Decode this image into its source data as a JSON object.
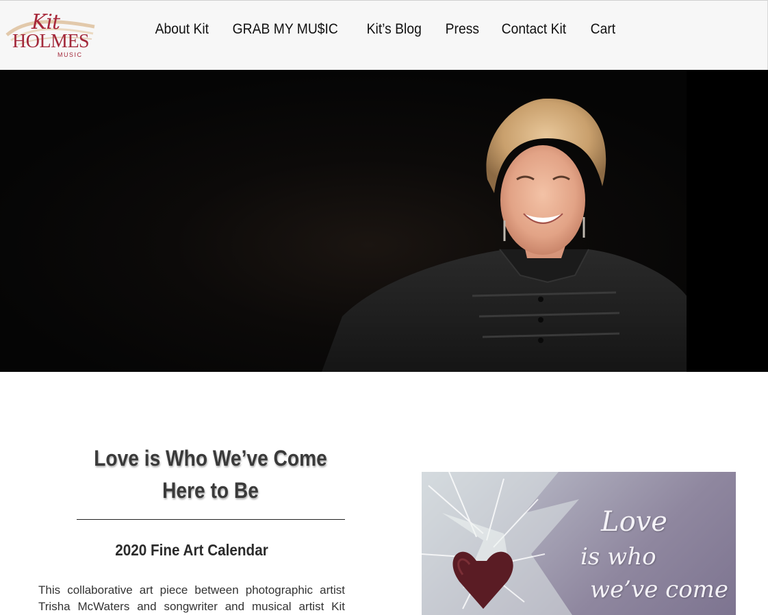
{
  "header": {
    "logo": {
      "script": "Kit",
      "name": "HOLMES",
      "tagline": "MUSIC"
    },
    "nav": [
      {
        "label": "About Kit"
      },
      {
        "label": "GRAB MY MU$IC"
      },
      {
        "label": "Kit’s Blog"
      },
      {
        "label": "Press"
      },
      {
        "label": "Contact Kit"
      },
      {
        "label": "Cart"
      }
    ]
  },
  "main": {
    "heading": "Love is Who We’ve Come Here to Be",
    "subheading": "2020 Fine Art Calendar",
    "body": "This collaborative art piece between photographic artist Trisha McWaters and songwriter and musical artist Kit",
    "calendar_image": {
      "line1": "Love",
      "line2": "is who",
      "line3": "we’ve come"
    }
  },
  "colors": {
    "brand": "#a3283a",
    "header_bg": "#f7f7f7",
    "hero_bg": "#050505"
  }
}
